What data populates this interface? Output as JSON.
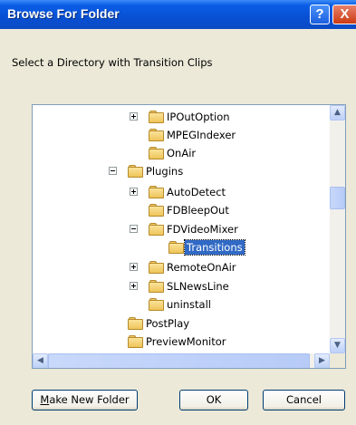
{
  "window": {
    "title": "Browse For Folder",
    "help_label": "?",
    "close_label": "X"
  },
  "instruction": "Select a Directory with Transition Clips",
  "tree": {
    "items": [
      {
        "label": "IPOutOption",
        "expander": "plus",
        "selected": false
      },
      {
        "label": "MPEGIndexer",
        "expander": "none",
        "selected": false
      },
      {
        "label": "OnAir",
        "expander": "none",
        "selected": false
      },
      {
        "label": "Plugins",
        "expander": "minus",
        "selected": false
      },
      {
        "label": "AutoDetect",
        "expander": "plus",
        "selected": false
      },
      {
        "label": "FDBleepOut",
        "expander": "none",
        "selected": false
      },
      {
        "label": "FDVideoMixer",
        "expander": "minus",
        "selected": false
      },
      {
        "label": "Transitions",
        "expander": "none",
        "selected": true
      },
      {
        "label": "RemoteOnAir",
        "expander": "plus",
        "selected": false
      },
      {
        "label": "SLNewsLine",
        "expander": "plus",
        "selected": false
      },
      {
        "label": "uninstall",
        "expander": "none",
        "selected": false
      },
      {
        "label": "PostPlay",
        "expander": "none",
        "selected": false
      },
      {
        "label": "PreviewMonitor",
        "expander": "none",
        "selected": false
      }
    ]
  },
  "buttons": {
    "make_new_folder_rest": "ake New Folder",
    "make_new_folder_mnemonic": "M",
    "ok": "OK",
    "cancel": "Cancel"
  }
}
